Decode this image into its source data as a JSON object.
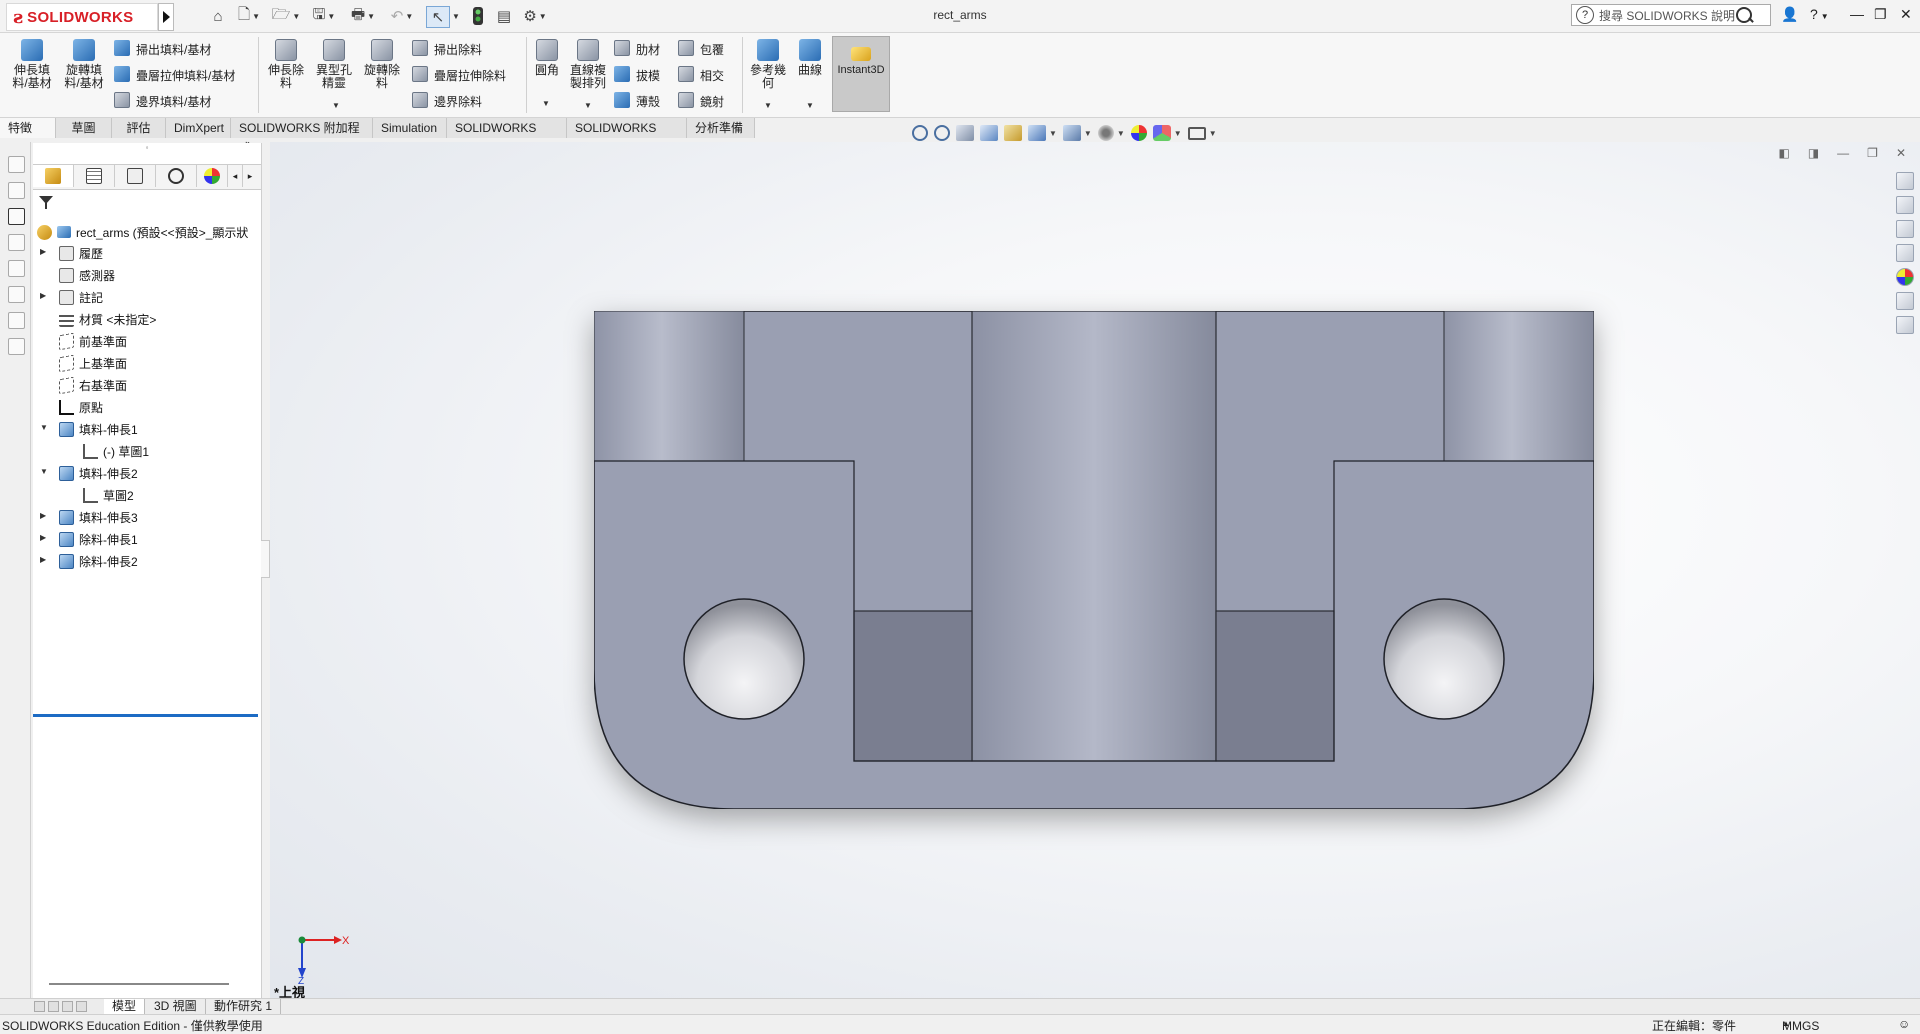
{
  "app": {
    "brand_ds": "ƨ",
    "brand_name": "SOLIDWORKS",
    "document_title": "rect_arms",
    "search_placeholder": "搜尋 SOLIDWORKS 說明",
    "search_help_glyph": "?",
    "window_help": "?"
  },
  "ribbon": {
    "extrude_boss": "伸長填\n料/基材",
    "revolve_boss": "旋轉填\n料/基材",
    "swept_boss": "掃出填料/基材",
    "loft_boss": "疊層拉伸填料/基材",
    "boundary_boss": "邊界填料/基材",
    "extrude_cut": "伸長除\n料",
    "hole_wizard": "異型孔\n精靈",
    "revolve_cut": "旋轉除\n料",
    "swept_cut": "掃出除料",
    "loft_cut": "疊層拉伸除料",
    "boundary_cut": "邊界除料",
    "fillet": "圓角",
    "linear_pattern": "直線複\n製排列",
    "rib": "肋材",
    "wrap": "包覆",
    "draft": "拔模",
    "intersect": "相交",
    "shell": "薄殼",
    "mirror": "鏡射",
    "reference_geometry": "參考幾\n何",
    "curves": "曲線",
    "instant3d": "Instant3D"
  },
  "tabs": [
    "特徵",
    "草圖",
    "評估",
    "DimXpert",
    "SOLIDWORKS 附加程式",
    "Simulation",
    "SOLIDWORKS MBD",
    "SOLIDWORKS CAM",
    "分析準備"
  ],
  "tree": {
    "root": "rect_arms  (預設<<預設>_顯示狀",
    "items": {
      "history": "履歷",
      "sensors": "感測器",
      "annotations": "註記",
      "material": "材質 <未指定>",
      "front_plane": "前基準面",
      "top_plane": "上基準面",
      "right_plane": "右基準面",
      "origin": "原點",
      "boss_extrude1": "填料-伸長1",
      "sketch1": "(-) 草圖1",
      "boss_extrude2": "填料-伸長2",
      "sketch2": "草圖2",
      "boss_extrude3": "填料-伸長3",
      "cut_extrude1": "除料-伸長1",
      "cut_extrude2": "除料-伸長2"
    }
  },
  "viewport": {
    "view_name": "*上視",
    "triad_x": "X",
    "triad_z": "Z"
  },
  "bottom_tabs": [
    "模型",
    "3D 視圖",
    "動作研究 1"
  ],
  "status": {
    "edition": "SOLIDWORKS Education Edition - 僅供教學使用",
    "editing": "正在編輯：零件",
    "units": "MMGS",
    "units_arrow": "▲"
  },
  "colors": {
    "brand_red": "#d82027",
    "model_face": "#9a9fb2",
    "model_face_dark": "#7a7e90",
    "rollback_bar": "#1c6bc4"
  }
}
